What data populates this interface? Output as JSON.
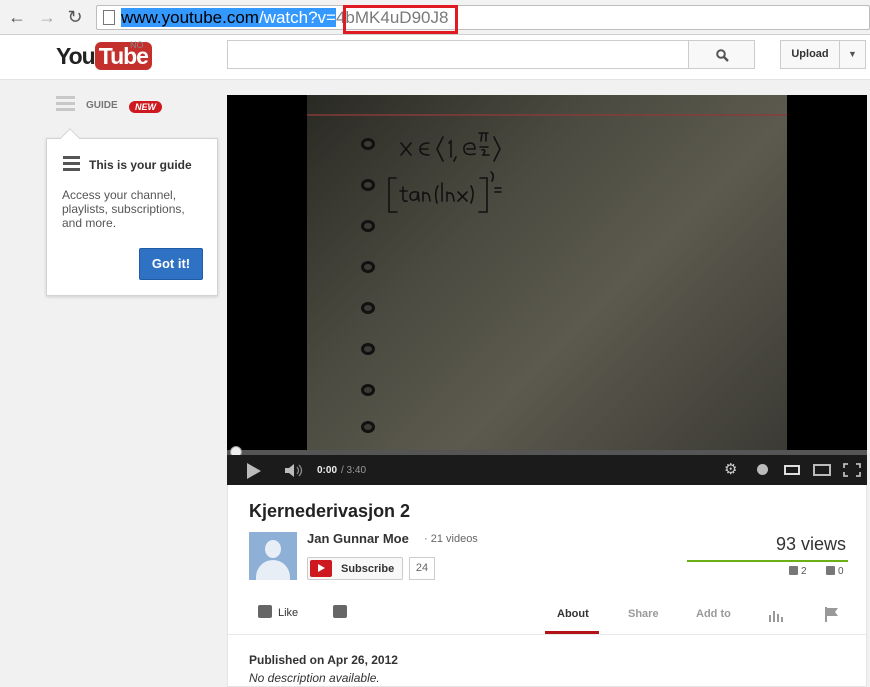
{
  "browser": {
    "url_selected": "www.youtube.com",
    "url_path": "/watch?v=",
    "url_video_id": "4bMK4uD90J8"
  },
  "header": {
    "logo_you": "You",
    "logo_tube": "Tube",
    "country_code": "NO",
    "search_placeholder": "",
    "upload_label": "Upload"
  },
  "guide": {
    "label": "GUIDE",
    "new_badge": "NEW",
    "popup_title": "This is your guide",
    "popup_text": "Access your channel, playlists, subscriptions, and more.",
    "got_it_label": "Got it!"
  },
  "player": {
    "time_current": "0:00",
    "time_total": "/ 3:40",
    "progress": 0
  },
  "video": {
    "title": "Kjernederivasjon 2",
    "channel_name": "Jan Gunnar Moe",
    "channel_videos": "· 21 videos",
    "subscribe_label": "Subscribe",
    "subscriber_count": "24",
    "view_count": "93 views",
    "likes": "2",
    "dislikes": "0",
    "like_label": "Like",
    "tabs": {
      "about": "About",
      "share": "Share",
      "add_to": "Add to"
    },
    "published": "Published on Apr 26, 2012",
    "description": "No description available."
  },
  "colors": {
    "accent_red": "#cc181e",
    "got_it_blue": "#2f72c4",
    "sentiment_green": "#6ab014",
    "url_highlight": "#e01b24"
  }
}
